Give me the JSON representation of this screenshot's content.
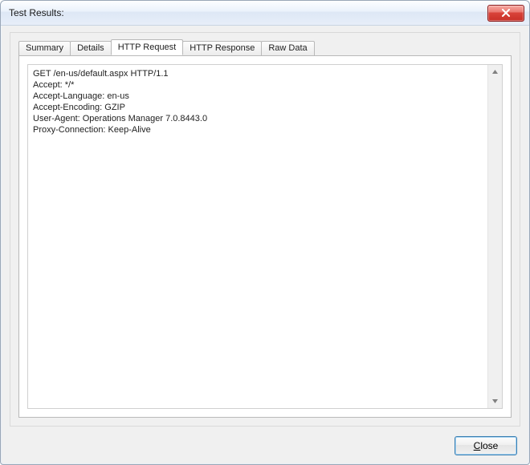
{
  "window": {
    "title": "Test Results:"
  },
  "tabs": [
    {
      "label": "Summary"
    },
    {
      "label": "Details"
    },
    {
      "label": "HTTP Request"
    },
    {
      "label": "HTTP Response"
    },
    {
      "label": "Raw Data"
    }
  ],
  "active_tab_index": 2,
  "request_text": "GET /en-us/default.aspx HTTP/1.1\nAccept: */*\nAccept-Language: en-us\nAccept-Encoding: GZIP\nUser-Agent: Operations Manager 7.0.8443.0\nProxy-Connection: Keep-Alive\n",
  "buttons": {
    "close": "Close"
  }
}
